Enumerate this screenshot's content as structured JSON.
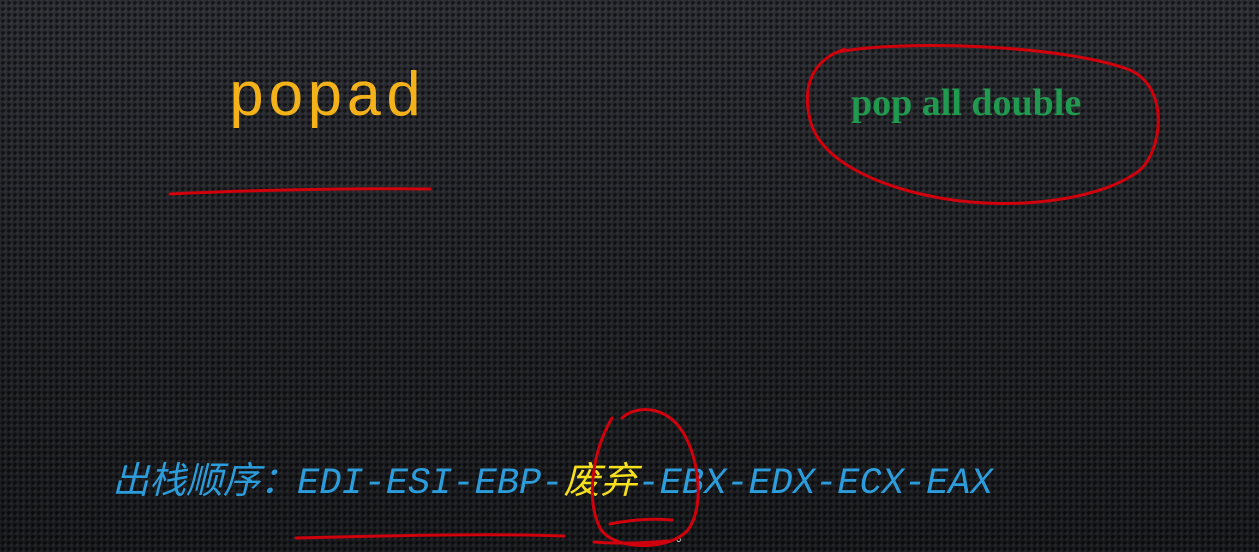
{
  "slide": {
    "title": "popad",
    "note": "pop all double",
    "order": {
      "label": "出栈顺序：",
      "before_discard": "EDI-ESI-EBP-",
      "discard": "废弃",
      "after_discard": "-EBX-EDX-ECX-EAX"
    },
    "trailing_mark": "。"
  },
  "colors": {
    "title": "#f3b21a",
    "note": "#1f9a4f",
    "order_text": "#2c9ddc",
    "discard": "#f6e01c",
    "annotation_ink": "#d0000c",
    "background": "#202226"
  }
}
